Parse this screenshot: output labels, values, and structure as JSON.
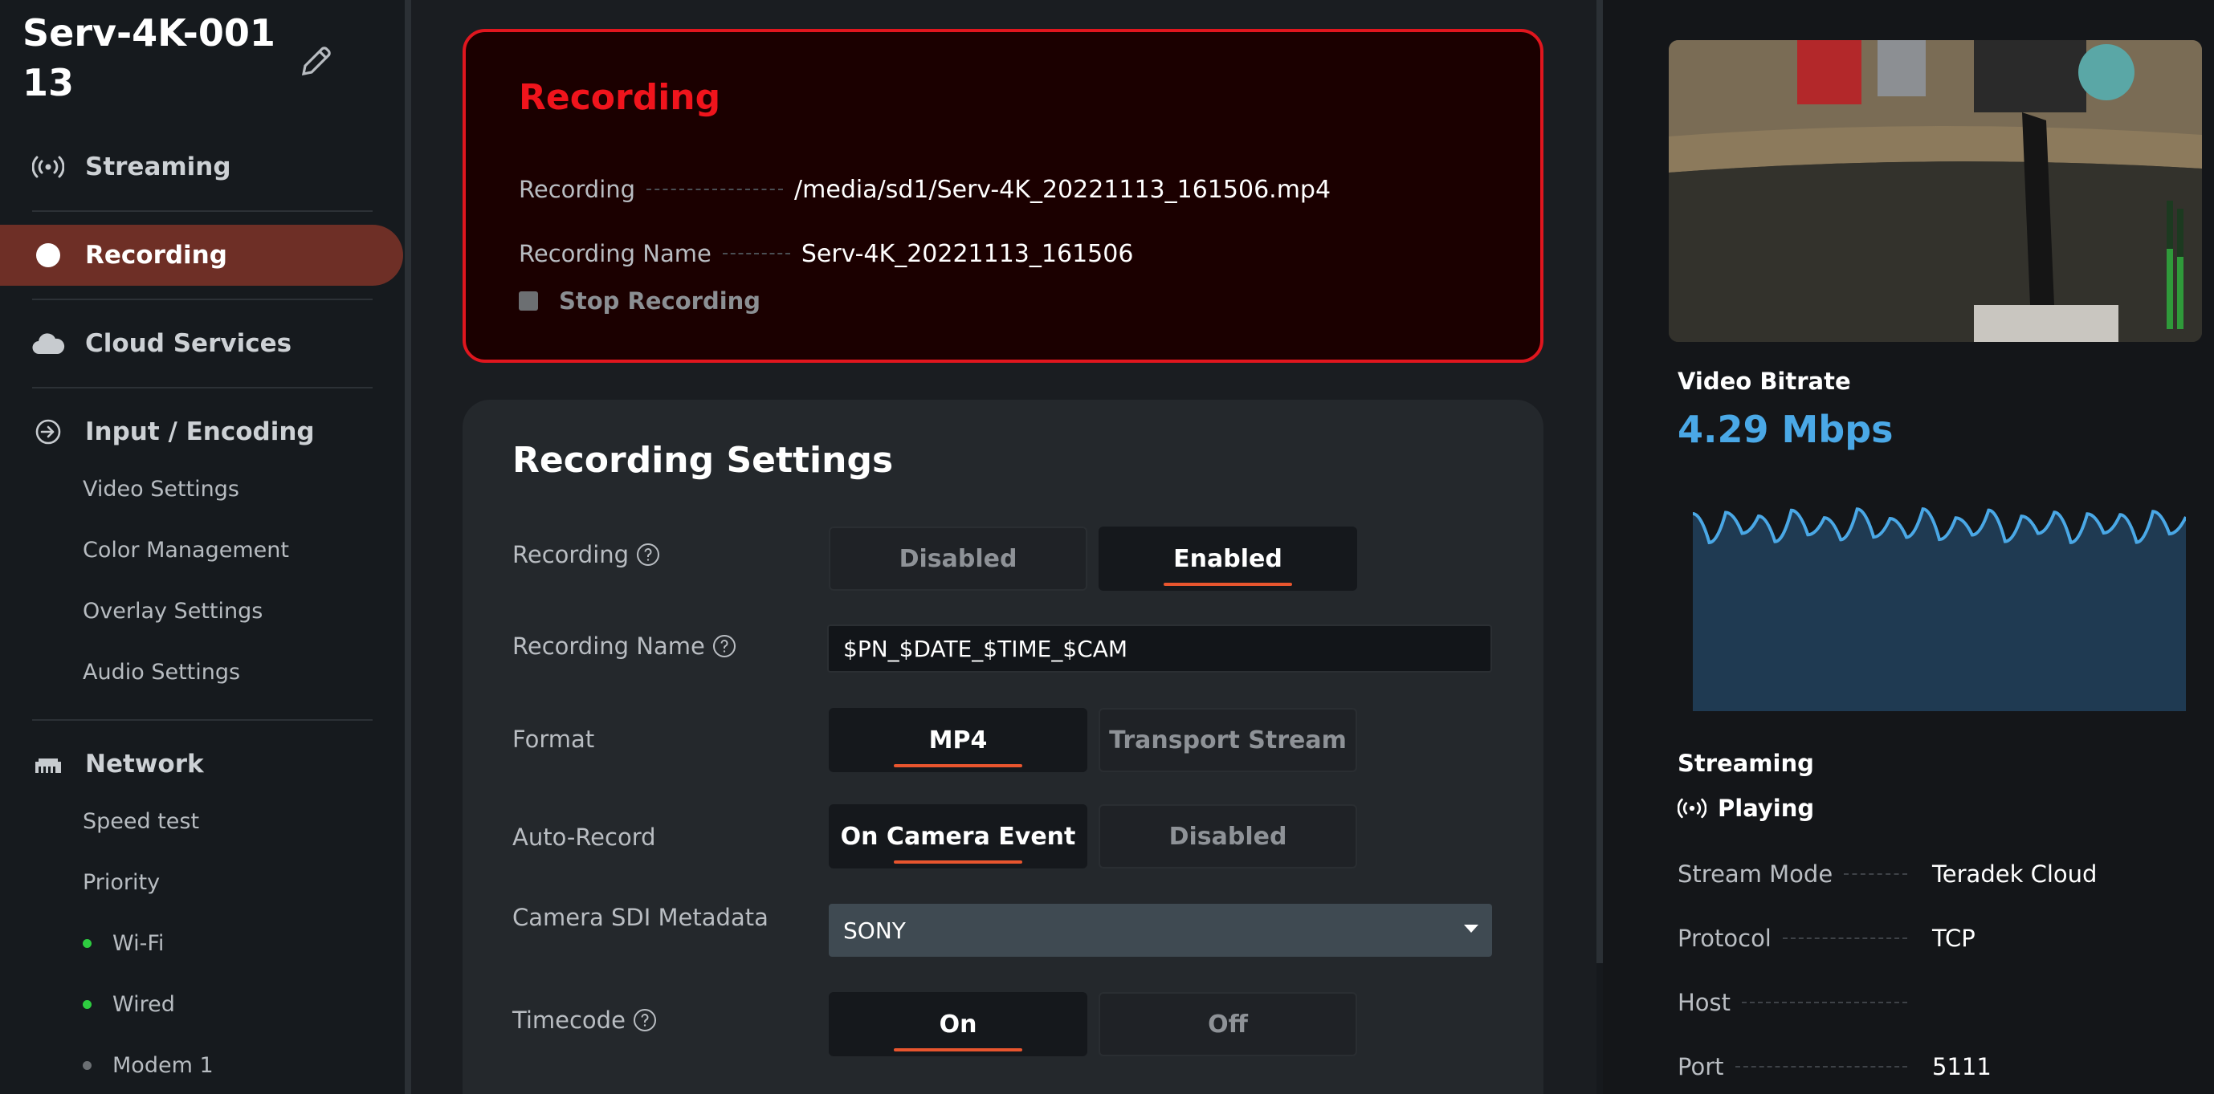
{
  "device": {
    "name": "Serv-4K-00113"
  },
  "sidebar": {
    "nav": [
      {
        "label": "Streaming",
        "icon": "broadcast-icon"
      },
      {
        "label": "Recording",
        "icon": "record-dot-icon"
      },
      {
        "label": "Cloud Services",
        "icon": "cloud-icon"
      },
      {
        "label": "Input / Encoding",
        "icon": "input-arrow-icon"
      },
      {
        "label": "Network",
        "icon": "network-icon"
      }
    ],
    "input_sub": [
      "Video Settings",
      "Color Management",
      "Overlay Settings",
      "Audio Settings"
    ],
    "network_sub": [
      "Speed test",
      "Priority"
    ],
    "network_links": [
      {
        "label": "Wi-Fi",
        "status_color": "#2ecc40"
      },
      {
        "label": "Wired",
        "status_color": "#2ecc40"
      },
      {
        "label": "Modem 1",
        "status_color": "#6b6f73"
      }
    ]
  },
  "recording_card": {
    "title": "Recording",
    "rows": [
      {
        "key": "Recording",
        "value": "/media/sd1/Serv-4K_20221113_161506.mp4"
      },
      {
        "key": "Recording Name",
        "value": "Serv-4K_20221113_161506"
      }
    ],
    "stop_label": "Stop Recording"
  },
  "settings": {
    "title": "Recording Settings",
    "recording": {
      "label": "Recording",
      "options": [
        "Disabled",
        "Enabled"
      ],
      "selected": "Enabled"
    },
    "recording_name": {
      "label": "Recording Name",
      "value": "$PN_$DATE_$TIME_$CAM"
    },
    "format": {
      "label": "Format",
      "options": [
        "MP4",
        "Transport Stream"
      ],
      "selected": "MP4"
    },
    "auto_record": {
      "label": "Auto-Record",
      "options": [
        "On Camera Event",
        "Disabled"
      ],
      "selected": "On Camera Event"
    },
    "sdi_metadata": {
      "label": "Camera SDI Metadata",
      "value": "SONY"
    },
    "timecode": {
      "label": "Timecode",
      "options": [
        "On",
        "Off"
      ],
      "selected": "On"
    }
  },
  "right_panel": {
    "bitrate_label": "Video Bitrate",
    "bitrate_value": "4.29 Mbps",
    "streaming_label": "Streaming",
    "streaming_status": "Playing",
    "details": [
      {
        "key": "Stream Mode",
        "value": "Teradek Cloud"
      },
      {
        "key": "Protocol",
        "value": "TCP"
      },
      {
        "key": "Host",
        "value": ""
      },
      {
        "key": "Port",
        "value": "5111"
      }
    ],
    "accent_color": "#4aa8e6"
  }
}
